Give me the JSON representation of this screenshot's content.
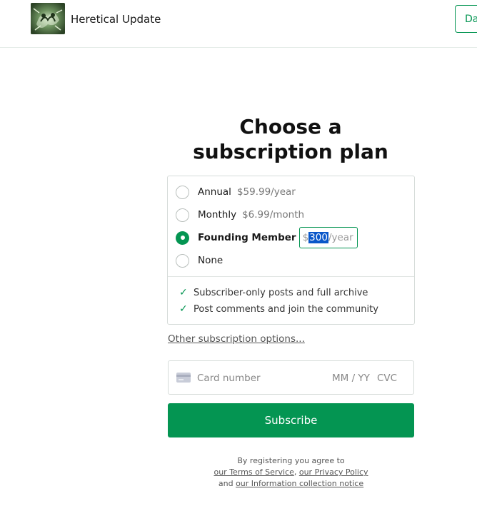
{
  "header": {
    "publication_name": "Heretical Update",
    "dashboard_button_label": "Dashboard"
  },
  "main": {
    "title_line1": "Choose a",
    "title_line2": "subscription plan"
  },
  "plans": [
    {
      "name": "Annual",
      "price": "$59.99/year",
      "selected": false
    },
    {
      "name": "Monthly",
      "price": "$6.99/month",
      "selected": false
    },
    {
      "name": "Founding Member",
      "price_currency": "$",
      "price_amount": "300",
      "price_period": "/year",
      "selected": true
    },
    {
      "name": "None",
      "selected": false
    }
  ],
  "features": [
    "Subscriber-only posts and full archive",
    "Post comments and join the community"
  ],
  "other_options_link": "Other subscription options...",
  "card": {
    "number_placeholder": "Card number",
    "expiry_placeholder": "MM / YY",
    "cvc_placeholder": "CVC"
  },
  "subscribe_button": "Subscribe",
  "legal": {
    "prefix": "By registering you agree to",
    "terms_link": "our Terms of Service",
    "separator": ",",
    "privacy_link": "our Privacy Policy",
    "and": "and",
    "info_link": "our Information collection notice"
  },
  "colors": {
    "accent": "#049552",
    "selection_highlight": "#0a57c9"
  },
  "icons": {
    "check": "✓"
  }
}
